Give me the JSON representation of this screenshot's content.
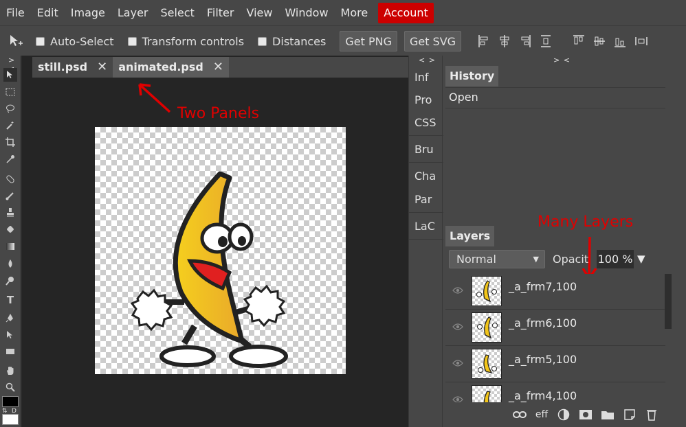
{
  "menu": {
    "items": [
      "File",
      "Edit",
      "Image",
      "Layer",
      "Select",
      "Filter",
      "View",
      "Window",
      "More"
    ],
    "account": "Account"
  },
  "options": {
    "auto_select": "Auto-Select",
    "transform_controls": "Transform controls",
    "distances": "Distances",
    "get_png": "Get PNG",
    "get_svg": "Get SVG"
  },
  "tools": {
    "collapse": "> <",
    "text_tool": "T",
    "swap_label": "⇅",
    "default_label": "D"
  },
  "documents": {
    "tabs": [
      {
        "name": "still.psd",
        "active": true
      },
      {
        "name": "animated.psd",
        "active": false
      }
    ],
    "close_glyph": "✕"
  },
  "annotations": {
    "two_panels": "Two Panels",
    "many_layers": "Many Layers"
  },
  "mini_panel": {
    "collapse": "< >",
    "items": [
      "Inf",
      "Pro",
      "CSS",
      "Bru",
      "Cha",
      "Par",
      "LaC"
    ]
  },
  "right_panel": {
    "collapse": "> <",
    "history_tab": "History",
    "history_items": [
      "Open"
    ],
    "layers_tab": "Layers",
    "blend_mode": "Normal",
    "opacity_label": "Opacit",
    "opacity_value": "100 %",
    "layers": [
      {
        "name": "_a_frm7,100"
      },
      {
        "name": "_a_frm6,100"
      },
      {
        "name": "_a_frm5,100"
      },
      {
        "name": "_a_frm4,100"
      }
    ],
    "footer": {
      "effects": "eff"
    }
  },
  "colors": {
    "account_bg": "#cc0000",
    "annotation": "#e00000",
    "banana": "#f2c51a",
    "mouth": "#e02020"
  }
}
